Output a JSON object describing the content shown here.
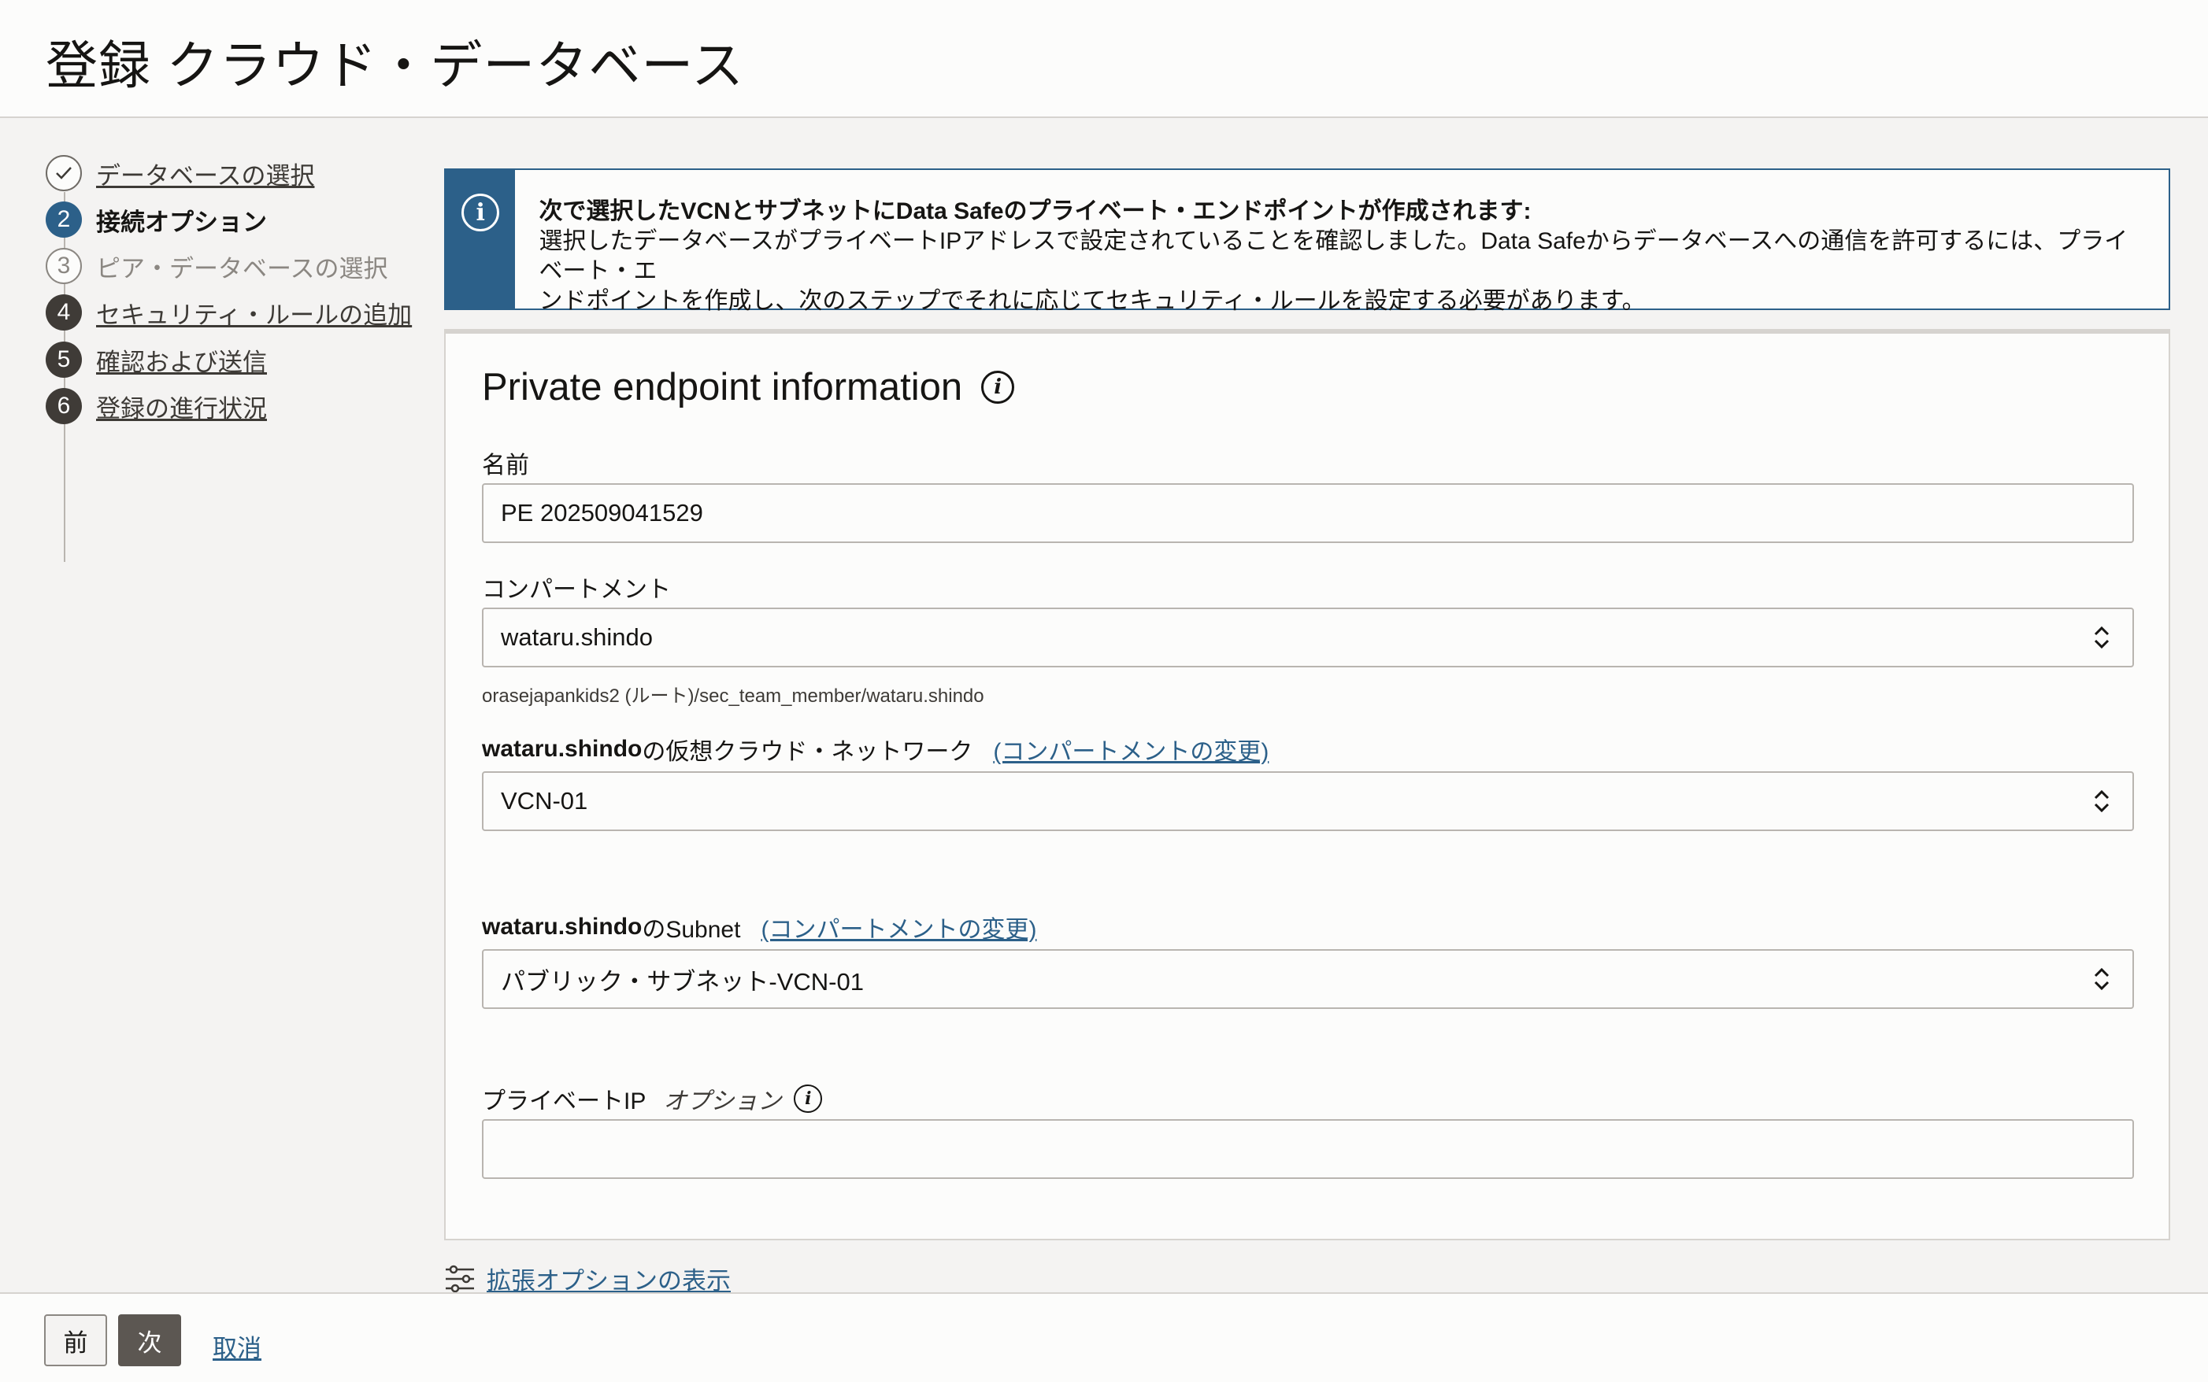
{
  "header": {
    "title": "登録 クラウド・データベース"
  },
  "stepper": {
    "steps": [
      {
        "number": "✓",
        "label": "データベースの選択"
      },
      {
        "number": "2",
        "label": "接続オプション"
      },
      {
        "number": "3",
        "label": "ピア・データベースの選択"
      },
      {
        "number": "4",
        "label": "セキュリティ・ルールの追加"
      },
      {
        "number": "5",
        "label": "確認および送信"
      },
      {
        "number": "6",
        "label": "登録の進行状況"
      }
    ]
  },
  "banner": {
    "title": "次で選択したVCNとサブネットにData Safeのプライベート・エンドポイントが作成されます:",
    "line1": "選択したデータベースがプライベートIPアドレスで設定されていることを確認しました。Data Safeからデータベースへの通信を許可するには、プライベート・エ",
    "line2": "ンドポイントを作成し、次のステップでそれに応じてセキュリティ・ルールを設定する必要があります。"
  },
  "panel": {
    "title": "Private endpoint information",
    "name_label": "名前",
    "name_value": "PE 202509041529",
    "compartment_label": "コンパートメント",
    "compartment_value": "wataru.shindo",
    "compartment_path": "orasejapankids2 (ルート)/sec_team_member/wataru.shindo",
    "vcn_label_bold": "wataru.shindo",
    "vcn_label_rest": "の仮想クラウド・ネットワーク",
    "change_compartment": "(コンパートメントの変更)",
    "vcn_value": "VCN-01",
    "subnet_label_bold": "wataru.shindo",
    "subnet_label_rest": "のSubnet",
    "subnet_value": "パブリック・サブネット-VCN-01",
    "private_ip_label": "プライベートIP",
    "optional": "オプション",
    "private_ip_value": ""
  },
  "advanced": {
    "label": "拡張オプションの表示"
  },
  "footer": {
    "prev": "前",
    "next": "次",
    "cancel": "取消"
  },
  "colors": {
    "accent": "#2c6089",
    "primary_button": "#5c5752"
  }
}
